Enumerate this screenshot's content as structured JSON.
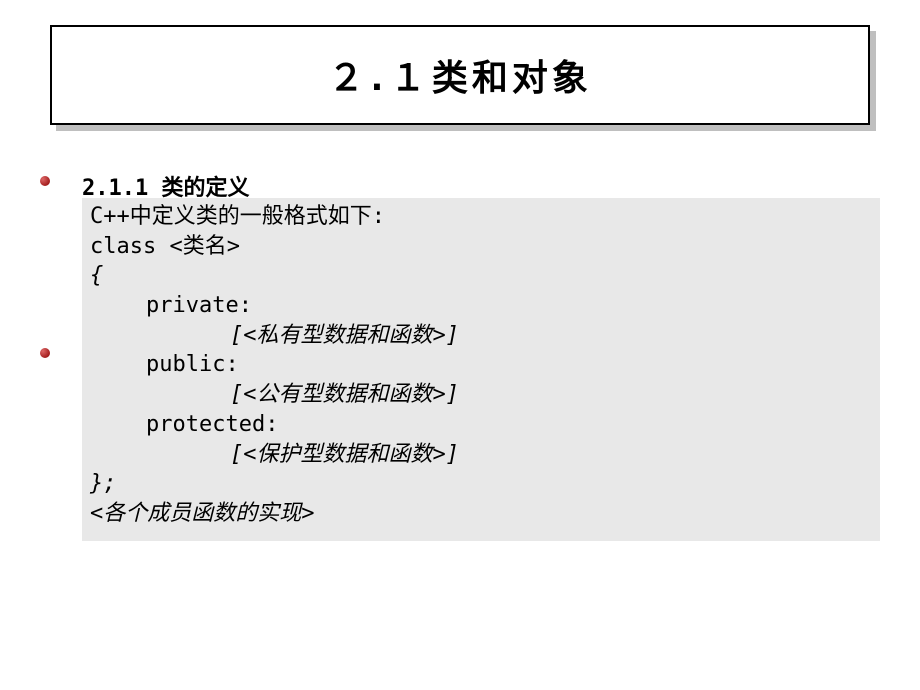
{
  "title": {
    "number": "２.１",
    "text": "类和对象"
  },
  "section": {
    "heading": "2.1.1  类的定义"
  },
  "code": {
    "line1": "C++中定义类的一般格式如下:",
    "line2": "class <类名>",
    "line3": "{",
    "line4": "private:",
    "line5": "[<私有型数据和函数>]",
    "line6": "public:",
    "line7": "[<公有型数据和函数>]",
    "line8": "protected:",
    "line9": "[<保护型数据和函数>]",
    "line10": "};",
    "line11": "<各个成员函数的实现>"
  }
}
